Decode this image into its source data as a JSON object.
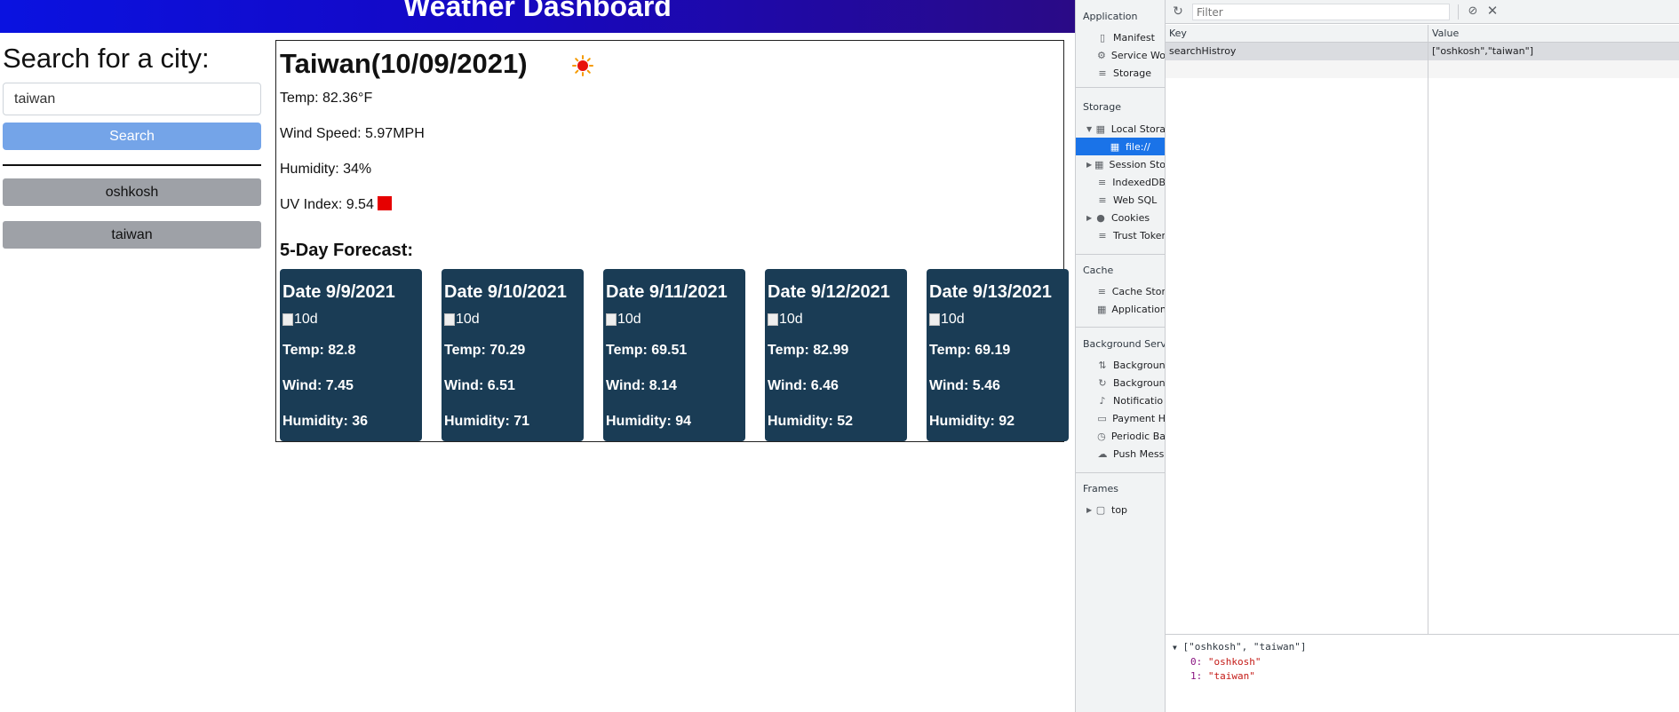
{
  "app": {
    "header_title": "Weather Dashboard",
    "search": {
      "heading": "Search for a city:",
      "input_value": "taiwan",
      "button_label": "Search"
    },
    "history": [
      "oshkosh",
      "taiwan"
    ],
    "current": {
      "title": "Taiwan(10/09/2021)",
      "temp": "Temp: 82.36°F",
      "wind": "Wind Speed: 5.97MPH",
      "humidity": "Humidity: 34%",
      "uv": "UV Index: 9.54",
      "uv_color": "#e60000",
      "icon": "sun-icon"
    },
    "forecast_heading": "5-Day Forecast:",
    "forecast": [
      {
        "date": "Date 9/9/2021",
        "img_alt": "10d",
        "temp": "Temp: 82.8",
        "wind": "Wind: 7.45",
        "humidity": "Humidity: 36"
      },
      {
        "date": "Date 9/10/2021",
        "img_alt": "10d",
        "temp": "Temp: 70.29",
        "wind": "Wind: 6.51",
        "humidity": "Humidity: 71"
      },
      {
        "date": "Date 9/11/2021",
        "img_alt": "10d",
        "temp": "Temp: 69.51",
        "wind": "Wind: 8.14",
        "humidity": "Humidity: 94"
      },
      {
        "date": "Date 9/12/2021",
        "img_alt": "10d",
        "temp": "Temp: 82.99",
        "wind": "Wind: 6.46",
        "humidity": "Humidity: 52"
      },
      {
        "date": "Date 9/13/2021",
        "img_alt": "10d",
        "temp": "Temp: 69.19",
        "wind": "Wind: 5.46",
        "humidity": "Humidity: 92"
      }
    ],
    "colors": {
      "header_start": "#0a12e0",
      "header_end": "#2a0a86",
      "search_button": "#74a4e8",
      "history_button": "#9ea1a7",
      "card": "#1a3c55"
    }
  },
  "devtools": {
    "sidebar": {
      "application_label": "Application",
      "application_items": [
        "Manifest",
        "Service Wo",
        "Storage"
      ],
      "storage_label": "Storage",
      "storage_items": [
        "Local Stora",
        "file://",
        "Session Sto",
        "IndexedDB",
        "Web SQL",
        "Cookies",
        "Trust Toker"
      ],
      "cache_label": "Cache",
      "cache_items": [
        "Cache Stor",
        "Application"
      ],
      "background_label": "Background Servi",
      "background_items": [
        "Backgroun",
        "Backgroun",
        "Notificatio",
        "Payment H",
        "Periodic Ba",
        "Push Mess"
      ],
      "frames_label": "Frames",
      "frames_items": [
        "top"
      ]
    },
    "toolbar": {
      "filter_placeholder": "Filter"
    },
    "table": {
      "key_header": "Key",
      "value_header": "Value",
      "rows": [
        {
          "key": "searchHistroy",
          "value": "[\"oshkosh\",\"taiwan\"]"
        }
      ]
    },
    "preview": {
      "root": "[\"oshkosh\", \"taiwan\"]",
      "items": [
        {
          "index": "0:",
          "value": "\"oshkosh\""
        },
        {
          "index": "1:",
          "value": "\"taiwan\""
        }
      ]
    }
  }
}
